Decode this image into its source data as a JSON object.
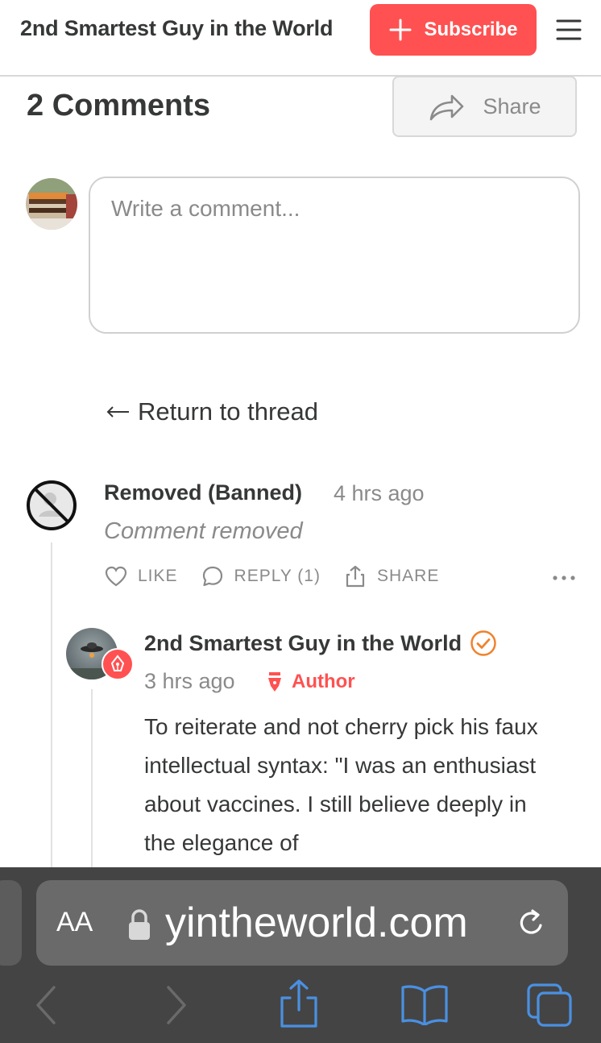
{
  "header": {
    "publication_name": "2nd Smartest Guy in the World",
    "subscribe_label": "Subscribe"
  },
  "comments_section": {
    "title": "2 Comments",
    "share_label": "Share",
    "composer_placeholder": "Write a comment...",
    "return_link": "Return to thread"
  },
  "comments": [
    {
      "author": "Removed (Banned)",
      "time": "4 hrs ago",
      "body": "Comment removed",
      "actions": {
        "like": "LIKE",
        "reply": "REPLY (1)",
        "share": "SHARE"
      }
    },
    {
      "author": "2nd Smartest Guy in the World",
      "time": "3 hrs ago",
      "badge": "Author",
      "body": "To reiterate and not cherry pick his faux intellectual syntax: \"I was an enthusiast about vaccines. I still believe deeply in the elegance of"
    }
  ],
  "browser": {
    "aa_label": "AA",
    "url": "yintheworld.com"
  },
  "colors": {
    "accent": "#ff5151",
    "verified": "#f0822d",
    "ios_blue": "#4a90e2",
    "browser_bar": "#444444"
  }
}
